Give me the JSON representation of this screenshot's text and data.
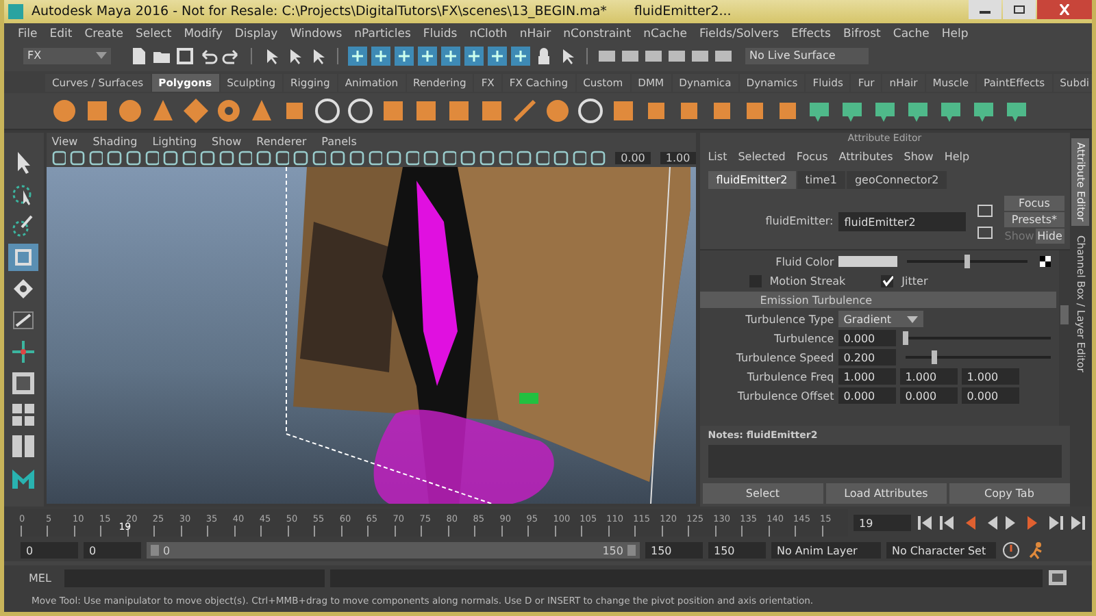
{
  "window": {
    "title": "Autodesk Maya 2016 - Not for Resale: C:\\Projects\\DigitalTutors\\FX\\scenes\\13_BEGIN.ma*",
    "subtitle": "fluidEmitter2..."
  },
  "menu_bar": [
    "File",
    "Edit",
    "Create",
    "Select",
    "Modify",
    "Display",
    "Windows",
    "nParticles",
    "Fluids",
    "nCloth",
    "nHair",
    "nConstraint",
    "nCache",
    "Fields/Solvers",
    "Effects",
    "Bifrost",
    "Cache",
    "Help"
  ],
  "status_line": {
    "menu_set": "FX",
    "live_surface": "No Live Surface"
  },
  "shelf_tabs": [
    {
      "label": "Curves / Surfaces",
      "selected": false
    },
    {
      "label": "Polygons",
      "selected": true
    },
    {
      "label": "Sculpting",
      "selected": false
    },
    {
      "label": "Rigging",
      "selected": false
    },
    {
      "label": "Animation",
      "selected": false
    },
    {
      "label": "Rendering",
      "selected": false
    },
    {
      "label": "FX",
      "selected": false
    },
    {
      "label": "FX Caching",
      "selected": false
    },
    {
      "label": "Custom",
      "selected": false
    },
    {
      "label": "DMM",
      "selected": false
    },
    {
      "label": "Dynamica",
      "selected": false
    },
    {
      "label": "Dynamics",
      "selected": false
    },
    {
      "label": "Fluids",
      "selected": false
    },
    {
      "label": "Fur",
      "selected": false
    },
    {
      "label": "nHair",
      "selected": false
    },
    {
      "label": "Muscle",
      "selected": false
    },
    {
      "label": "PaintEffects",
      "selected": false
    },
    {
      "label": "Subdi",
      "selected": false
    }
  ],
  "toolbox": [
    {
      "kind": "select",
      "selected": false
    },
    {
      "kind": "lasso",
      "selected": false
    },
    {
      "kind": "paint",
      "selected": false
    },
    {
      "kind": "move",
      "selected": true
    },
    {
      "kind": "rotate",
      "selected": false
    },
    {
      "kind": "scale",
      "selected": false
    },
    {
      "kind": "last",
      "selected": false
    },
    {
      "kind": "layout-single",
      "selected": false
    },
    {
      "kind": "layout-four",
      "selected": false
    },
    {
      "kind": "layout-split",
      "selected": false
    },
    {
      "kind": "logo",
      "selected": false
    }
  ],
  "viewport": {
    "menus": [
      "View",
      "Shading",
      "Lighting",
      "Show",
      "Renderer",
      "Panels"
    ],
    "fields": [
      "0.00",
      "1.00"
    ]
  },
  "attribute_editor": {
    "title": "Attribute Editor",
    "menus": [
      "List",
      "Selected",
      "Focus",
      "Attributes",
      "Show",
      "Help"
    ],
    "tabs": [
      {
        "label": "fluidEmitter2",
        "selected": true
      },
      {
        "label": "time1",
        "selected": false
      },
      {
        "label": "geoConnector2",
        "selected": false
      }
    ],
    "node_label": "fluidEmitter:",
    "node_value": "fluidEmitter2",
    "buttons": [
      "Focus",
      "Presets*"
    ],
    "show": {
      "label": "Show",
      "disabled": true
    },
    "hide": "Hide",
    "fluid_color": {
      "label": "Fluid Color",
      "level": 0.5
    },
    "checkboxes": [
      {
        "label": "Motion Streak",
        "checked": false
      },
      {
        "label": "Jitter",
        "checked": true
      }
    ],
    "section": "Emission Turbulence",
    "rows": [
      {
        "kind": "dropdown",
        "label": "Turbulence Type",
        "value": "Gradient"
      },
      {
        "kind": "slider",
        "label": "Turbulence",
        "value": "0.000",
        "level": 0
      },
      {
        "kind": "slider",
        "label": "Turbulence Speed",
        "value": "0.200",
        "level": 0.2
      },
      {
        "kind": "vector",
        "label": "Turbulence Freq",
        "values": [
          "1.000",
          "1.000",
          "1.000"
        ]
      },
      {
        "kind": "vector",
        "label": "Turbulence Offset",
        "values": [
          "0.000",
          "0.000",
          "0.000"
        ]
      }
    ],
    "notes_label": "Notes:  fluidEmitter2",
    "bottom_buttons": [
      "Select",
      "Load Attributes",
      "Copy Tab"
    ]
  },
  "side_tabs": [
    {
      "label": "Attribute Editor",
      "selected": true
    },
    {
      "label": "Channel Box / Layer Editor",
      "selected": false
    }
  ],
  "timeline": {
    "ticks": [
      "0",
      "5",
      "10",
      "15",
      "20",
      "25",
      "30",
      "35",
      "40",
      "45",
      "50",
      "55",
      "60",
      "65",
      "70",
      "75",
      "80",
      "85",
      "90",
      "95",
      "100",
      "105",
      "110",
      "115",
      "120",
      "125",
      "130",
      "135",
      "140",
      "145",
      "15"
    ],
    "playhead": {
      "label": "19",
      "level": 0.127
    },
    "current_frame": "19"
  },
  "range": {
    "level": 1,
    "start": "0",
    "playback_start": "0",
    "slider_start": "0",
    "slider_end": "150",
    "playback_end": "150",
    "end": "150",
    "anim_layer": "No Anim Layer",
    "character_set": "No Character Set"
  },
  "command_line": {
    "label": "MEL"
  },
  "help_line": "Move Tool: Use manipulator to move object(s). Ctrl+MMB+drag to move components along normals. Use D or INSERT to change the pivot position and axis orientation."
}
